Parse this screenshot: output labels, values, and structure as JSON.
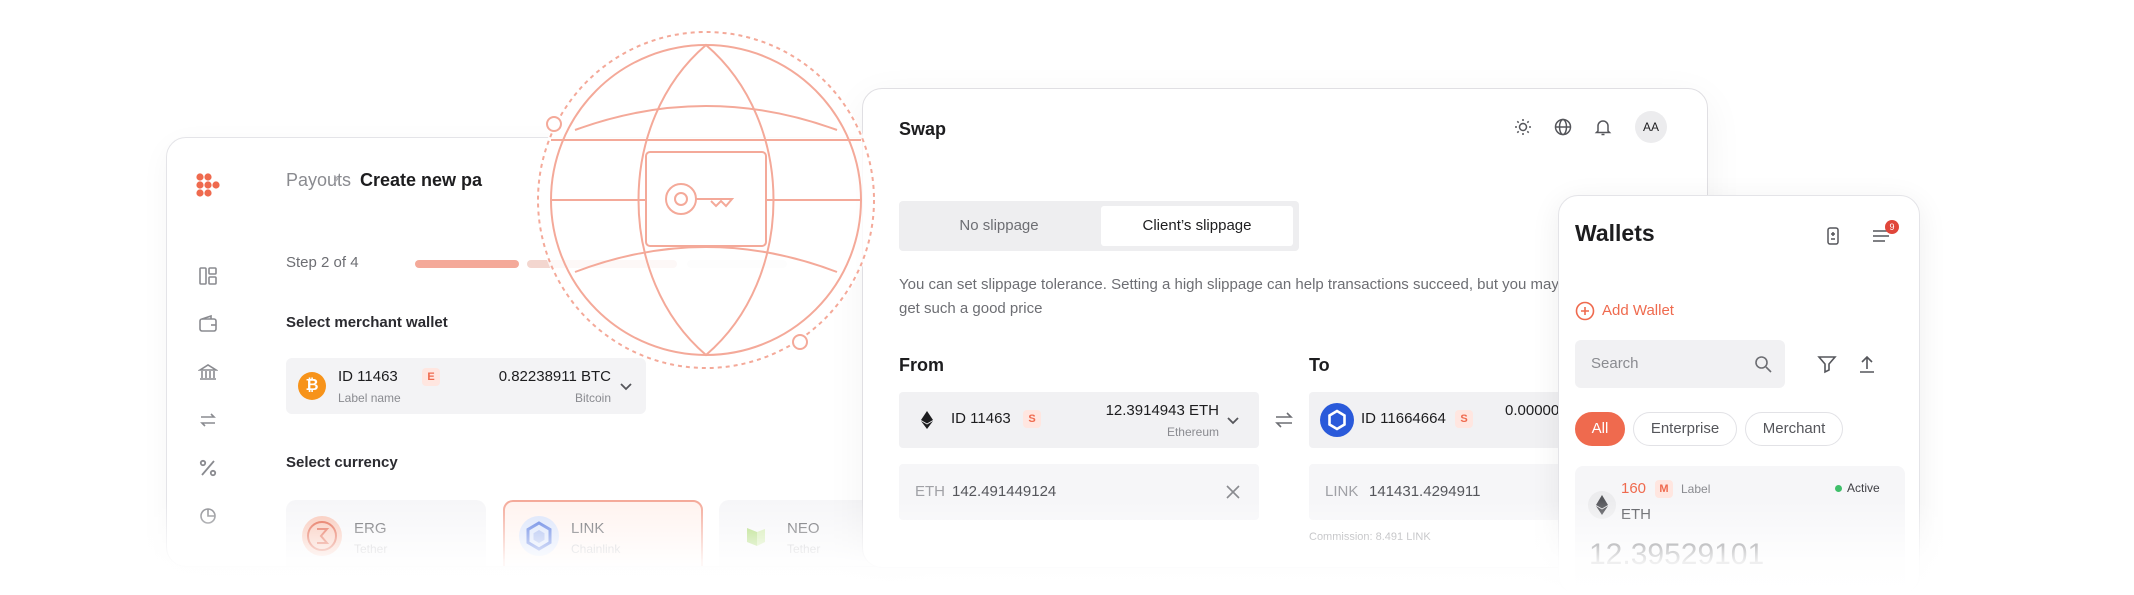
{
  "payouts": {
    "breadcrumb_root": "Payouts",
    "breadcrumb_current": "Create new pa",
    "step": "Step 2 of 4",
    "select_wallet_label": "Select merchant wallet",
    "wallet": {
      "id": "ID 11463",
      "tag": "E",
      "sub": "Label name",
      "amount": "0.82238911 BTC",
      "network": "Bitcoin",
      "coin_glyph": "₿"
    },
    "select_currency_label": "Select currency",
    "currencies": [
      {
        "name": "ERG",
        "sub": "Tether"
      },
      {
        "name": "LINK",
        "sub": "Chainlink"
      },
      {
        "name": "NEO",
        "sub": "Tether"
      }
    ]
  },
  "swap": {
    "title": "Swap",
    "avatar": "AA",
    "seg_no_slippage": "No slippage",
    "seg_client": "Client’s slippage",
    "note": "You can set slippage tolerance. Setting a high slippage can help transactions succeed, but you may not get such a good price",
    "from_label": "From",
    "to_label": "To",
    "from": {
      "id": "ID 11463",
      "tag": "S",
      "amount": "12.3914943 ETH",
      "network": "Ethereum",
      "input_cur": "ETH",
      "input_val": "142.491449124"
    },
    "to": {
      "id": "ID 11664664",
      "tag": "S",
      "amount": "0.00000",
      "input_cur": "LINK",
      "input_val": "141431.4294911",
      "commission": "Commission: 8.491 LINK"
    }
  },
  "wallets": {
    "title": "Wallets",
    "badge": "9",
    "add": "Add Wallet",
    "search_placeholder": "Search",
    "filters": [
      "All",
      "Enterprise",
      "Merchant"
    ],
    "item": {
      "id": "160",
      "tag": "M",
      "label": "Label",
      "status": "Active",
      "coin": "ETH",
      "balance": "12.39529101"
    }
  },
  "colors": {
    "accent": "#ef6a4e",
    "accent_light": "#f4a999",
    "text": "#1d1d1f",
    "muted": "#8a8b90"
  }
}
